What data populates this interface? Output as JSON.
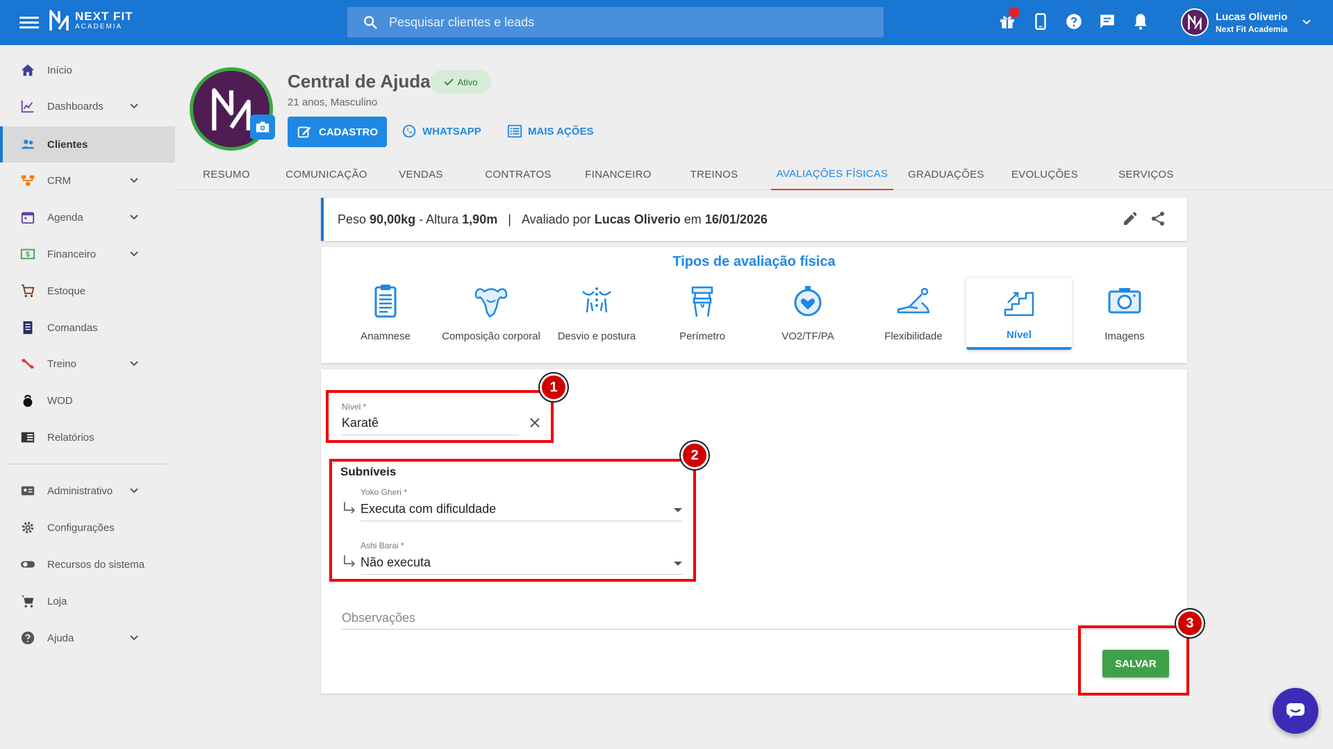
{
  "brand": {
    "line1": "NEXT FIT",
    "line2": "ACADEMIA"
  },
  "search": {
    "placeholder": "Pesquisar clientes e leads"
  },
  "user": {
    "name": "Lucas Oliverio",
    "org": "Next Fit Academia"
  },
  "sidebar": {
    "items": [
      {
        "label": "Início",
        "icon": "home-icon"
      },
      {
        "label": "Dashboards",
        "icon": "chart-icon",
        "expandable": true
      },
      {
        "label": "Clientes",
        "icon": "people-icon",
        "active": true
      },
      {
        "label": "CRM",
        "icon": "crm-icon",
        "expandable": true
      },
      {
        "label": "Agenda",
        "icon": "calendar-icon",
        "expandable": true
      },
      {
        "label": "Financeiro",
        "icon": "money-icon",
        "expandable": true
      },
      {
        "label": "Estoque",
        "icon": "cart-icon"
      },
      {
        "label": "Comandas",
        "icon": "receipt-icon"
      },
      {
        "label": "Treino",
        "icon": "dumbbell-icon",
        "expandable": true
      },
      {
        "label": "WOD",
        "icon": "kettlebell-icon"
      },
      {
        "label": "Relatórios",
        "icon": "report-icon"
      },
      {
        "label": "Administrativo",
        "icon": "id-card-icon",
        "expandable": true
      },
      {
        "label": "Configurações",
        "icon": "gear-icon"
      },
      {
        "label": "Recursos do sistema",
        "icon": "toggle-icon"
      },
      {
        "label": "Loja",
        "icon": "cart-icon"
      },
      {
        "label": "Ajuda",
        "icon": "help-icon",
        "expandable": true
      }
    ]
  },
  "profile": {
    "name": "Central de Ajuda",
    "status": "Ativo",
    "subtitle": "21 anos, Masculino",
    "btn_cadastro": "CADASTRO",
    "btn_whatsapp": "WHATSAPP",
    "btn_mais": "MAIS AÇÕES"
  },
  "tabs": [
    {
      "label": "RESUMO"
    },
    {
      "label": "COMUNICAÇÃO"
    },
    {
      "label": "VENDAS"
    },
    {
      "label": "CONTRATOS"
    },
    {
      "label": "FINANCEIRO"
    },
    {
      "label": "TREINOS"
    },
    {
      "label": "AVALIAÇÕES FÍSICAS",
      "active": true
    },
    {
      "label": "GRADUAÇÕES"
    },
    {
      "label": "EVOLUÇÕES"
    },
    {
      "label": "SERVIÇOS"
    }
  ],
  "info": {
    "peso_label": "Peso",
    "peso": "90,00kg",
    "altura_label": "- Altura",
    "altura": "1,90m",
    "sep": "|",
    "avaliado_label": "Avaliado por",
    "avaliador": "Lucas Oliverio",
    "em_label": "em",
    "data": "16/01/2026"
  },
  "types": {
    "title": "Tipos de avaliação física",
    "items": [
      {
        "label": "Anamnese",
        "icon": "clipboard-icon"
      },
      {
        "label": "Composição corporal",
        "icon": "muscle-torso-icon"
      },
      {
        "label": "Desvio e postura",
        "icon": "posture-icon"
      },
      {
        "label": "Perímetro",
        "icon": "measure-tape-icon"
      },
      {
        "label": "VO2/TF/PA",
        "icon": "heart-stopwatch-icon"
      },
      {
        "label": "Flexibilidade",
        "icon": "stretch-icon"
      },
      {
        "label": "Nível",
        "icon": "stairs-icon",
        "active": true
      },
      {
        "label": "Imagens",
        "icon": "camera-icon"
      }
    ]
  },
  "form": {
    "nivel_label": "Nível *",
    "nivel_value": "Karatê",
    "subniveis_title": "Subníveis",
    "sub1_label": "Yoko Gheri *",
    "sub1_value": "Executa com dificuldade",
    "sub2_label": "Ashi Barai *",
    "sub2_value": "Não executa",
    "obs_placeholder": "Observações",
    "save_label": "SALVAR"
  },
  "annotations": [
    "1",
    "2",
    "3"
  ],
  "colors": {
    "primary": "#1976d2",
    "accent": "#1e88e5",
    "success": "#3fa24a",
    "annotation": "#e00000",
    "avatar": "#4f1d54"
  }
}
